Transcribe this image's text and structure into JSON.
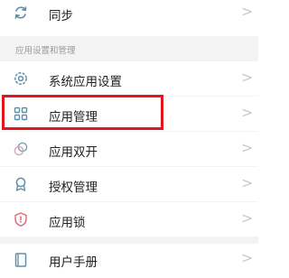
{
  "top_item": {
    "label": "同步",
    "icon": "sync-icon"
  },
  "section": {
    "title": "应用设置和管理"
  },
  "items": [
    {
      "label": "系统应用设置",
      "icon": "settings-gear-icon"
    },
    {
      "label": "应用管理",
      "icon": "grid-apps-icon",
      "highlighted": true
    },
    {
      "label": "应用双开",
      "icon": "dual-apps-icon"
    },
    {
      "label": "授权管理",
      "icon": "authorization-badge-icon"
    },
    {
      "label": "应用锁",
      "icon": "app-lock-shield-icon"
    }
  ],
  "bottom_item": {
    "label": "用户手册",
    "icon": "manual-book-icon"
  },
  "chevron": ">",
  "colors": {
    "highlight": "#e2151b",
    "icon": "#5f8fa6",
    "section_bg": "#f3f3f3"
  }
}
